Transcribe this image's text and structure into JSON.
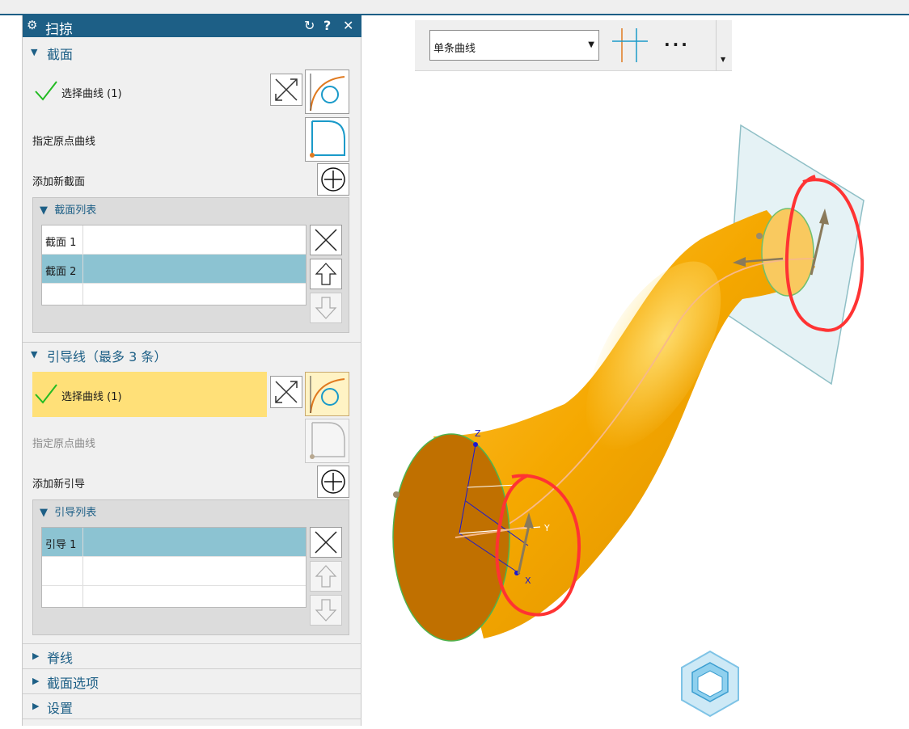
{
  "dialog": {
    "title": "扫掠",
    "title_icons": [
      "gear-icon",
      "reset-icon",
      "help-icon",
      "close-icon"
    ],
    "help_symbol": "?",
    "section": {
      "header": "截面",
      "select_curve": "选择曲线 (1)",
      "specify_origin": "指定原点曲线",
      "add_new": "添加新截面",
      "list_title": "截面列表",
      "items": [
        {
          "label": "截面 1",
          "selected": false
        },
        {
          "label": "截面 2",
          "selected": true
        }
      ]
    },
    "guide": {
      "header": "引导线（最多 3 条）",
      "select_curve": "选择曲线 (1)",
      "specify_origin": "指定原点曲线",
      "add_new": "添加新引导",
      "list_title": "引导列表",
      "items": [
        {
          "label": "引导 1",
          "selected": true
        }
      ]
    },
    "collapsed": {
      "spine": "脊线",
      "section_options": "截面选项",
      "settings": "设置"
    }
  },
  "toolbar": {
    "curve_rule": "单条曲线",
    "more": "···"
  },
  "viewport": {
    "axis_labels": {
      "x": "X",
      "y": "Y",
      "z": "Z"
    },
    "colors": {
      "surface": "#f5a800",
      "end_face": "#c07000",
      "annotation": "#ff3333",
      "plane": "#dceef2"
    }
  }
}
